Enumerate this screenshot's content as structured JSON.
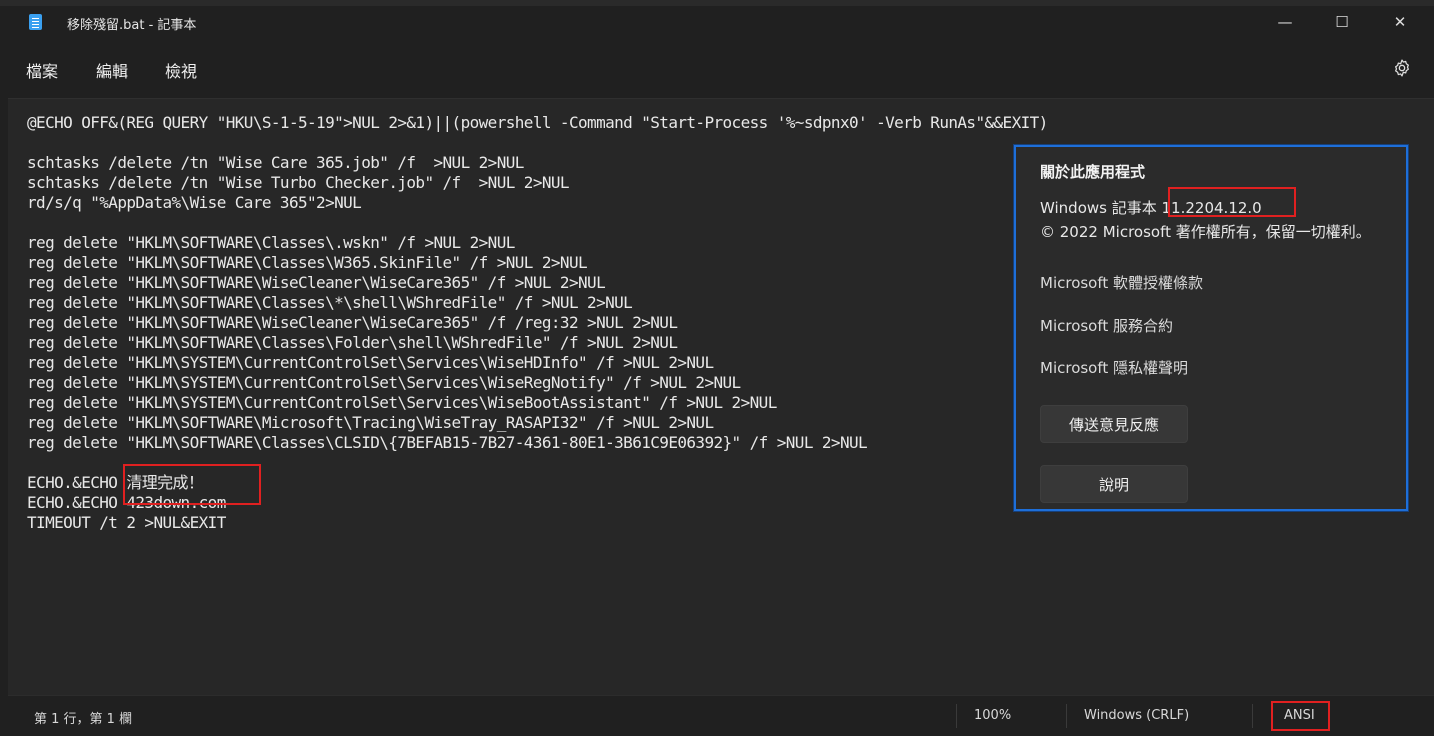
{
  "window": {
    "title": "移除殘留.bat - 記事本",
    "minimize_glyph": "—",
    "maximize_glyph": "☐",
    "close_glyph": "✕"
  },
  "menu": {
    "file": "檔案",
    "edit": "編輯",
    "view": "檢視"
  },
  "editor": {
    "lines": [
      "@ECHO OFF&(REG QUERY \"HKU\\S-1-5-19\">NUL 2>&1)||(powershell -Command \"Start-Process '%~sdpnx0' -Verb RunAs\"&&EXIT)",
      "",
      "schtasks /delete /tn \"Wise Care 365.job\" /f  >NUL 2>NUL",
      "schtasks /delete /tn \"Wise Turbo Checker.job\" /f  >NUL 2>NUL",
      "rd/s/q \"%AppData%\\Wise Care 365\"2>NUL",
      "",
      "reg delete \"HKLM\\SOFTWARE\\Classes\\.wskn\" /f >NUL 2>NUL",
      "reg delete \"HKLM\\SOFTWARE\\Classes\\W365.SkinFile\" /f >NUL 2>NUL",
      "reg delete \"HKLM\\SOFTWARE\\WiseCleaner\\WiseCare365\" /f >NUL 2>NUL",
      "reg delete \"HKLM\\SOFTWARE\\Classes\\*\\shell\\WShredFile\" /f >NUL 2>NUL",
      "reg delete \"HKLM\\SOFTWARE\\WiseCleaner\\WiseCare365\" /f /reg:32 >NUL 2>NUL",
      "reg delete \"HKLM\\SOFTWARE\\Classes\\Folder\\shell\\WShredFile\" /f >NUL 2>NUL",
      "reg delete \"HKLM\\SYSTEM\\CurrentControlSet\\Services\\WiseHDInfo\" /f >NUL 2>NUL",
      "reg delete \"HKLM\\SYSTEM\\CurrentControlSet\\Services\\WiseRegNotify\" /f >NUL 2>NUL",
      "reg delete \"HKLM\\SYSTEM\\CurrentControlSet\\Services\\WiseBootAssistant\" /f >NUL 2>NUL",
      "reg delete \"HKLM\\SOFTWARE\\Microsoft\\Tracing\\WiseTray_RASAPI32\" /f >NUL 2>NUL",
      "reg delete \"HKLM\\SOFTWARE\\Classes\\CLSID\\{7BEFAB15-7B27-4361-80E1-3B61C9E06392}\" /f >NUL 2>NUL",
      "",
      "ECHO.&ECHO 清理完成！",
      "ECHO.&ECHO 423down.com",
      "TIMEOUT /t 2 >NUL&EXIT"
    ]
  },
  "about": {
    "title": "關於此應用程式",
    "app_name": "Windows 記事本",
    "version": "11.2204.12.0",
    "copyright": "© 2022 Microsoft 著作權所有，保留一切權利。",
    "links": [
      "Microsoft 軟體授權條款",
      "Microsoft 服務合約",
      "Microsoft 隱私權聲明"
    ],
    "feedback_button": "傳送意見反應",
    "help_button": "說明"
  },
  "status": {
    "position": "第 1 行，第 1 欄",
    "zoom": "100%",
    "line_ending": "Windows (CRLF)",
    "encoding": "ANSI"
  },
  "colors": {
    "background": "#202020",
    "editor_background": "#272727",
    "dialog_border": "#1e6fd9",
    "highlight_box": "#e02020"
  }
}
